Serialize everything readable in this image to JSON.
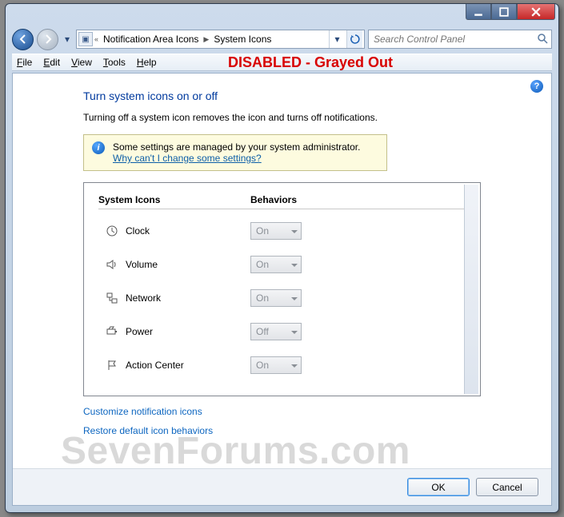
{
  "breadcrumb": {
    "items": [
      "Notification Area Icons",
      "System Icons"
    ]
  },
  "search": {
    "placeholder": "Search Control Panel"
  },
  "menu": {
    "file": "File",
    "edit": "Edit",
    "view": "View",
    "tools": "Tools",
    "help": "Help"
  },
  "annotation": "DISABLED - Grayed Out",
  "page": {
    "heading": "Turn system icons on or off",
    "subtext": "Turning off a system icon removes the icon and turns off notifications.",
    "info": {
      "line1": "Some settings are managed by your system administrator.",
      "link": "Why can't I change some settings?"
    },
    "columns": {
      "c1": "System Icons",
      "c2": "Behaviors"
    },
    "rows": [
      {
        "icon": "clock-icon",
        "label": "Clock",
        "value": "On"
      },
      {
        "icon": "volume-icon",
        "label": "Volume",
        "value": "On"
      },
      {
        "icon": "network-icon",
        "label": "Network",
        "value": "On"
      },
      {
        "icon": "power-icon",
        "label": "Power",
        "value": "Off"
      },
      {
        "icon": "flag-icon",
        "label": "Action Center",
        "value": "On"
      }
    ],
    "link1": "Customize notification icons",
    "link2": "Restore default icon behaviors"
  },
  "buttons": {
    "ok": "OK",
    "cancel": "Cancel"
  },
  "watermark": "SevenForums.com"
}
